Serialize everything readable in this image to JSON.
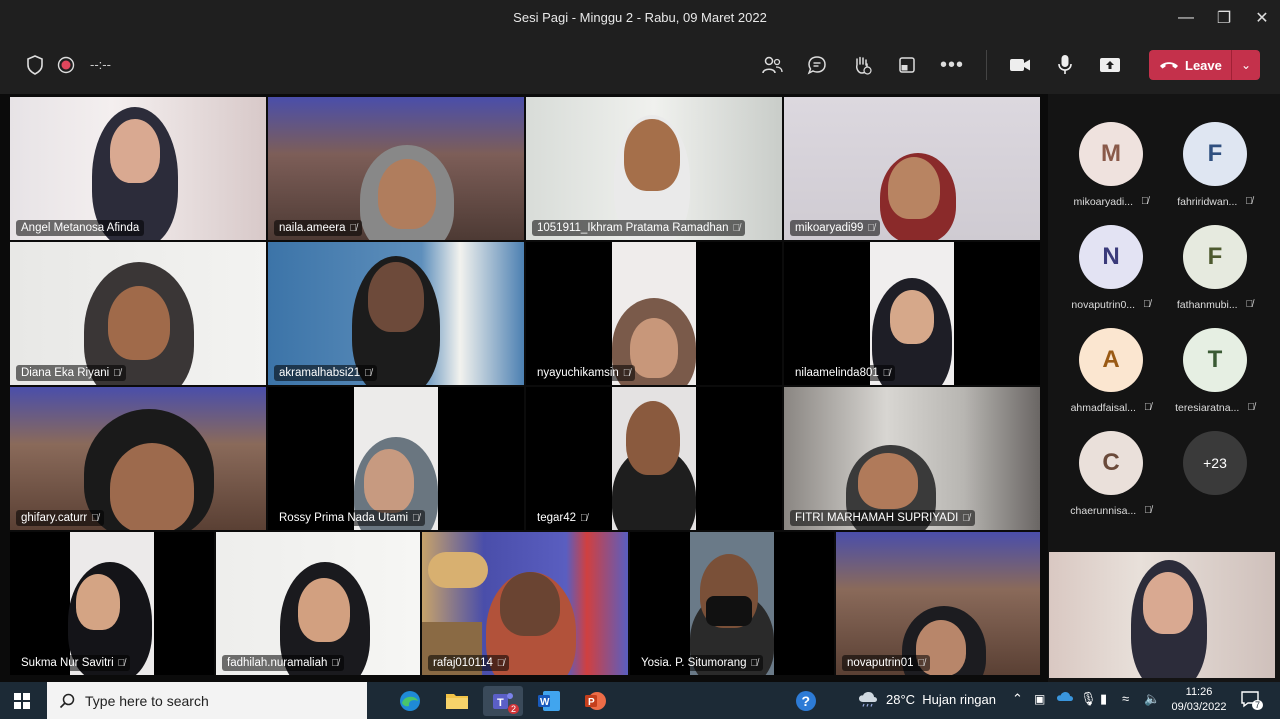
{
  "window": {
    "title": "Sesi Pagi - Minggu 2 - Rabu, 09 Maret 2022"
  },
  "toolbar": {
    "timer": "--:--",
    "leave_label": "Leave"
  },
  "tiles": [
    {
      "name": "Angel Metanosa Afinda",
      "muted": false
    },
    {
      "name": "naila.ameera",
      "muted": true
    },
    {
      "name": "1051911_Ikhram Pratama Ramadhan",
      "muted": true
    },
    {
      "name": "mikoaryadi99",
      "muted": true
    },
    {
      "name": "Diana Eka Riyani",
      "muted": true
    },
    {
      "name": "akramalhabsi21",
      "muted": true
    },
    {
      "name": "nyayuchikamsin",
      "muted": true
    },
    {
      "name": "nilaamelinda801",
      "muted": true
    },
    {
      "name": "ghifary.caturr",
      "muted": true
    },
    {
      "name": "Rossy Prima Nada Utami",
      "muted": true
    },
    {
      "name": "tegar42",
      "muted": true
    },
    {
      "name": "FITRI MARHAMAH SUPRIYADI",
      "muted": true
    },
    {
      "name": "Sukma Nur Savitri",
      "muted": true
    },
    {
      "name": "fadhilah.nuramaliah",
      "muted": true
    },
    {
      "name": "rafaj010114",
      "muted": true
    },
    {
      "name": "Yosia. P. Situmorang",
      "muted": true
    },
    {
      "name": "novaputrin01",
      "muted": true
    }
  ],
  "participants": [
    {
      "initial": "M",
      "name": "mikoaryadi...",
      "bg": "#efe2de",
      "fg": "#8a5a4a"
    },
    {
      "initial": "F",
      "name": "fahriridwan...",
      "bg": "#dfe6f2",
      "fg": "#2f4f7f"
    },
    {
      "initial": "N",
      "name": "novaputrin0...",
      "bg": "#e3e3f3",
      "fg": "#3a3a7a"
    },
    {
      "initial": "F",
      "name": "fathanmubi...",
      "bg": "#e6eadf",
      "fg": "#4d5a2f"
    },
    {
      "initial": "A",
      "name": "ahmadfaisal...",
      "bg": "#fbe6d0",
      "fg": "#9a5a14"
    },
    {
      "initial": "T",
      "name": "teresiaratna...",
      "bg": "#e6efe3",
      "fg": "#3a5a34"
    },
    {
      "initial": "C",
      "name": "chaerunnisa...",
      "bg": "#eae0da",
      "fg": "#6a4a3a"
    },
    {
      "initial": "+23",
      "name": "",
      "bg": "#3a3a3a",
      "fg": "#ffffff"
    }
  ],
  "taskbar": {
    "search_placeholder": "Type here to search",
    "teams_badge": "2",
    "weather": "28°C  Hujan ringan",
    "time": "11:26",
    "date": "09/03/2022",
    "notif_count": "7"
  }
}
